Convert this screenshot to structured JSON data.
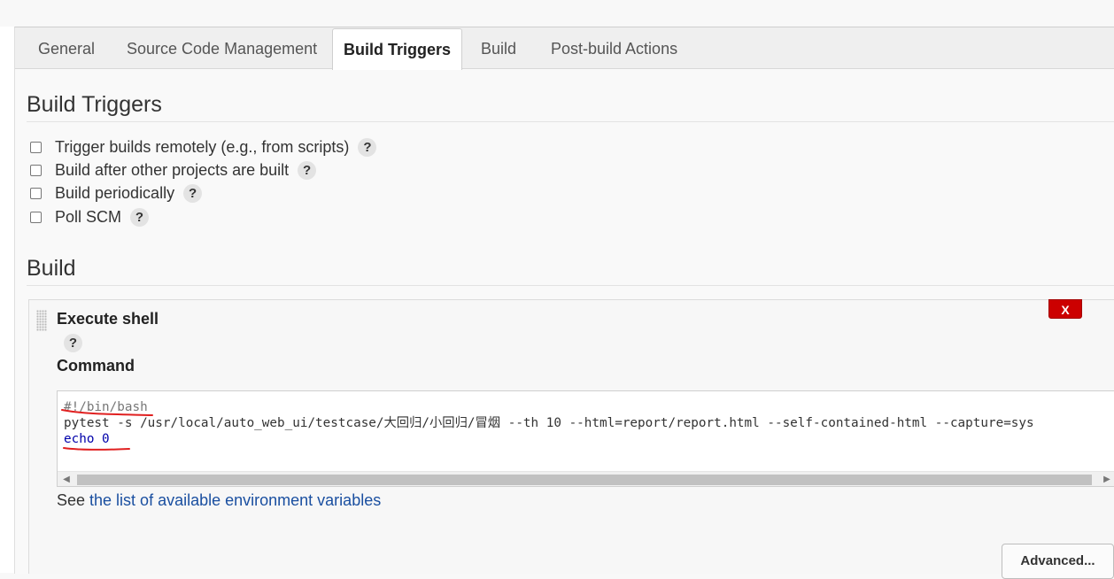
{
  "tabs": [
    {
      "label": "General",
      "active": false
    },
    {
      "label": "Source Code Management",
      "active": false
    },
    {
      "label": "Build Triggers",
      "active": true
    },
    {
      "label": "Build",
      "active": false
    },
    {
      "label": "Post-build Actions",
      "active": false
    }
  ],
  "build_triggers": {
    "title": "Build Triggers",
    "options": [
      {
        "label": "Trigger builds remotely (e.g., from scripts)",
        "checked": false
      },
      {
        "label": "Build after other projects are built",
        "checked": false
      },
      {
        "label": "Build periodically",
        "checked": false
      },
      {
        "label": "Poll SCM",
        "checked": false
      }
    ],
    "help_glyph": "?"
  },
  "build": {
    "title": "Build",
    "step": {
      "title": "Execute shell",
      "delete_label": "X",
      "help_glyph": "?",
      "command_label": "Command",
      "command_lines": [
        "#!/bin/bash",
        "pytest -s /usr/local/auto_web_ui/testcase/大回归/小回归/冒烟 --th 10 --html=report/report.html --self-contained-html --capture=sys",
        "echo 0"
      ],
      "env_prefix": "See ",
      "env_link": "the list of available environment variables",
      "advanced_label": "Advanced..."
    }
  },
  "colors": {
    "delete_red": "#cc0000",
    "link_blue": "#1a4fa0",
    "annotation_red": "#e02020"
  },
  "icons": {
    "help": "question-mark-circle-icon",
    "drag": "drag-handle-icon",
    "scroll_left": "triangle-left-icon",
    "scroll_right": "triangle-right-icon"
  }
}
